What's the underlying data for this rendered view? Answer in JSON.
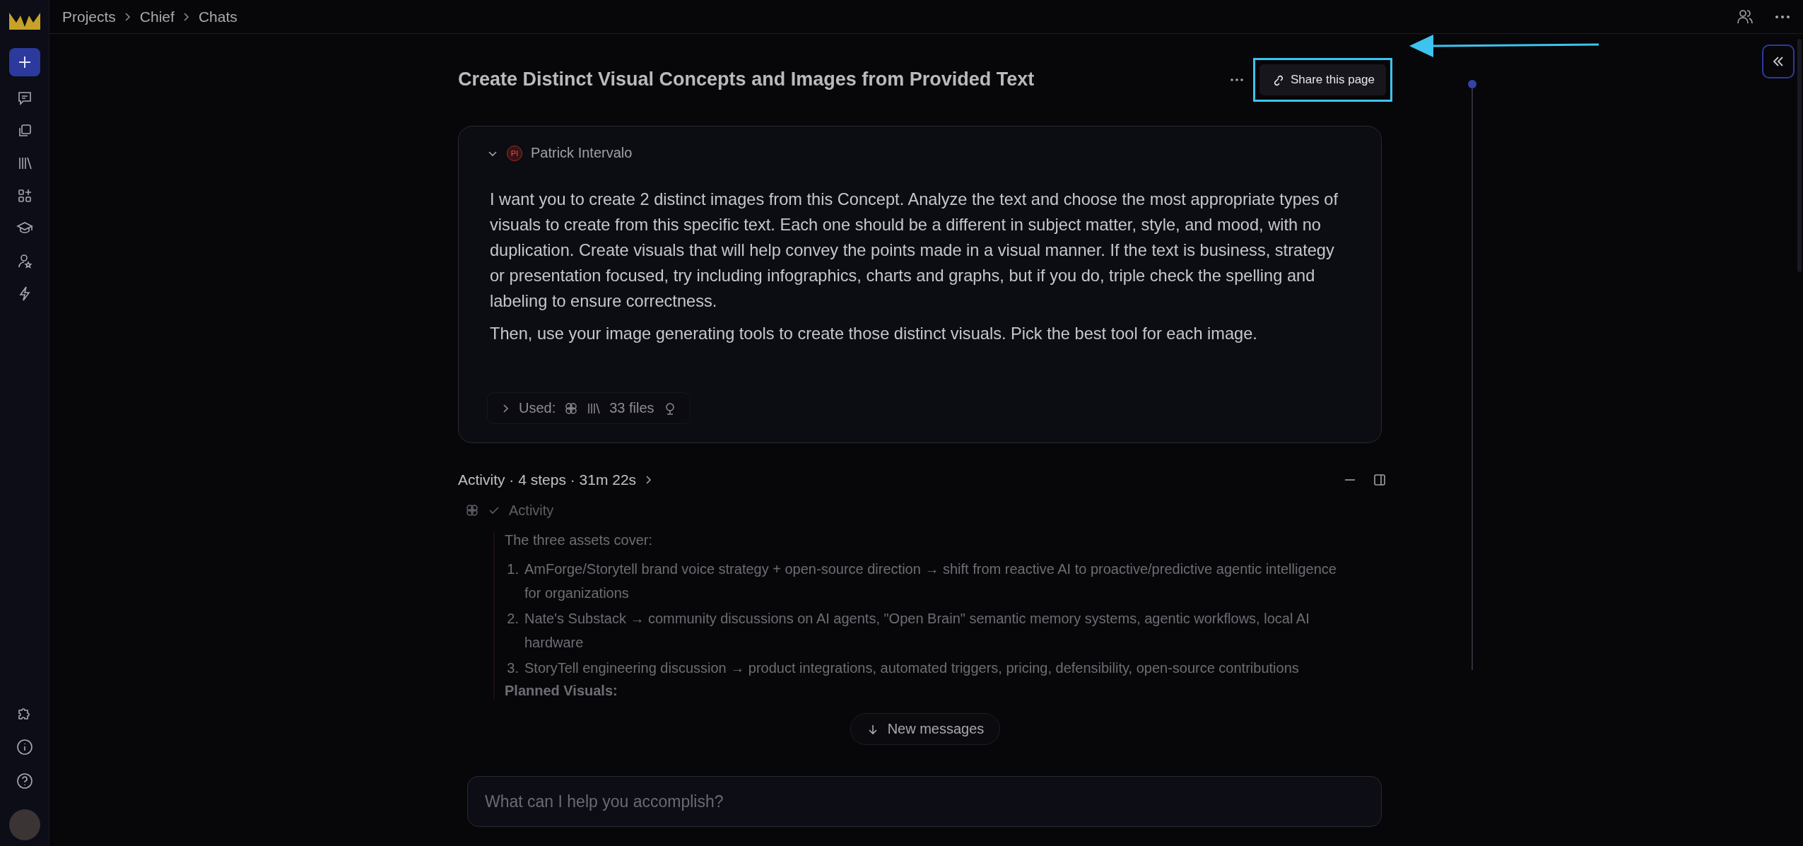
{
  "breadcrumb": [
    "Projects",
    "Chief",
    "Chats"
  ],
  "title": "Create Distinct Visual Concepts and Images from Provided Text",
  "share_button": {
    "label": "Share this page",
    "highlighted": true
  },
  "message": {
    "expanded": true,
    "initials": "PI",
    "author": "Patrick Intervalo",
    "paragraphs": [
      "I want you to create 2 distinct images from this Concept. Analyze the text and choose the most appropriate types of visuals to create from this specific text. Each one should be a different in subject matter, style, and mood, with no duplication. Create visuals that will help convey the points made in a visual manner. If the text is business, strategy or presentation focused, try including infographics, charts and graphs, but if you do, triple check the spelling and labeling to ensure correctness.",
      "Then, use your image generating tools to create those distinct visuals. Pick the best tool for each image."
    ],
    "used": {
      "label": "Used:",
      "files": "33 files"
    }
  },
  "activity": {
    "summary": "Activity · 4 steps · 31m 22s",
    "step": {
      "label": "Activity",
      "done": true,
      "intro": "The three assets cover:",
      "items": [
        {
          "marker": "1.",
          "text": "AmForge/Storytell brand voice strategy + open-source direction → shift from reactive AI to proactive/predictive agentic intelligence for organizations"
        },
        {
          "marker": "2.",
          "text": "Nate's Substack → community discussions on AI agents, \"Open Brain\" semantic memory systems, agentic workflows, local AI hardware"
        },
        {
          "marker": "3.",
          "text": "StoryTell engineering discussion → product integrations, automated triggers, pricing, defensibility, open-source contributions"
        }
      ],
      "heading": "Planned Visuals:"
    }
  },
  "new_messages": "New messages",
  "composer": {
    "placeholder": "What can I help you accomplish?"
  }
}
